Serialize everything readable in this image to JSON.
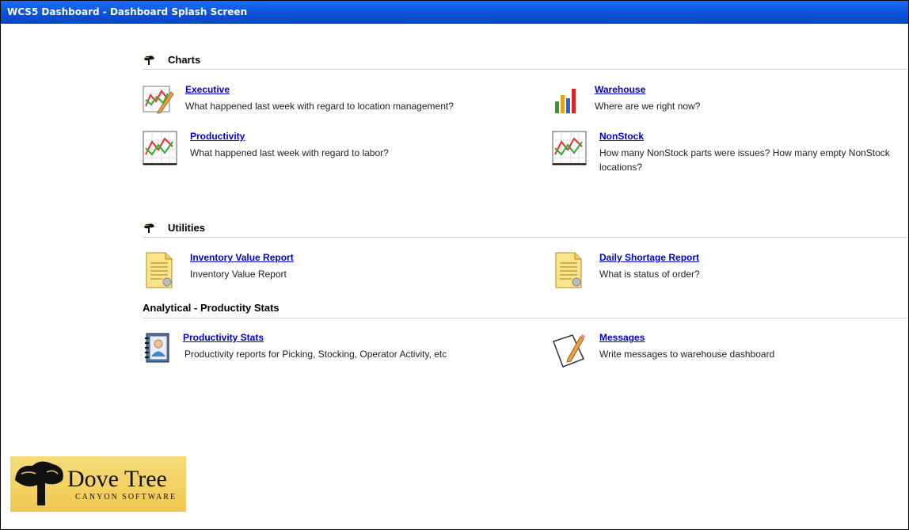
{
  "window": {
    "title": "WCS5 Dashboard - Dashboard Splash Screen"
  },
  "sections": {
    "charts": {
      "heading": "Charts",
      "items": [
        {
          "label": "Executive",
          "desc": "What happened last week with regard to location management?",
          "icon": "chart-pencil-icon"
        },
        {
          "label": "Warehouse",
          "desc": "Where are we right now?",
          "icon": "bar-chart-icon"
        },
        {
          "label": "Productivity",
          "desc": "What happened last week with regard to labor?",
          "icon": "line-chart-icon"
        },
        {
          "label": "NonStock",
          "desc": "How many NonStock parts were issues? How many empty NonStock locations?",
          "icon": "line-chart-icon"
        }
      ]
    },
    "utilities": {
      "heading": "Utilities",
      "items": [
        {
          "label": "Inventory Value Report",
          "desc": "Inventory Value Report",
          "icon": "report-document-icon"
        },
        {
          "label": "Daily Shortage Report",
          "desc": "What is status of order?",
          "icon": "report-document-icon"
        }
      ]
    },
    "analytical": {
      "heading": "Analytical - Productity Stats",
      "items": [
        {
          "label": "Productivity Stats",
          "desc": "Productivity reports for Picking, Stocking, Operator Activity, etc",
          "icon": "address-book-icon"
        },
        {
          "label": "Messages",
          "desc": "Write messages to warehouse dashboard",
          "icon": "write-message-icon"
        }
      ]
    }
  },
  "logo": {
    "brand": "Dove Tree",
    "sub": "CANYON SOFTWARE"
  },
  "colors": {
    "titlebar": "#0a4fd8",
    "link": "#0000cc",
    "logo_bg": "#f0c84f"
  }
}
